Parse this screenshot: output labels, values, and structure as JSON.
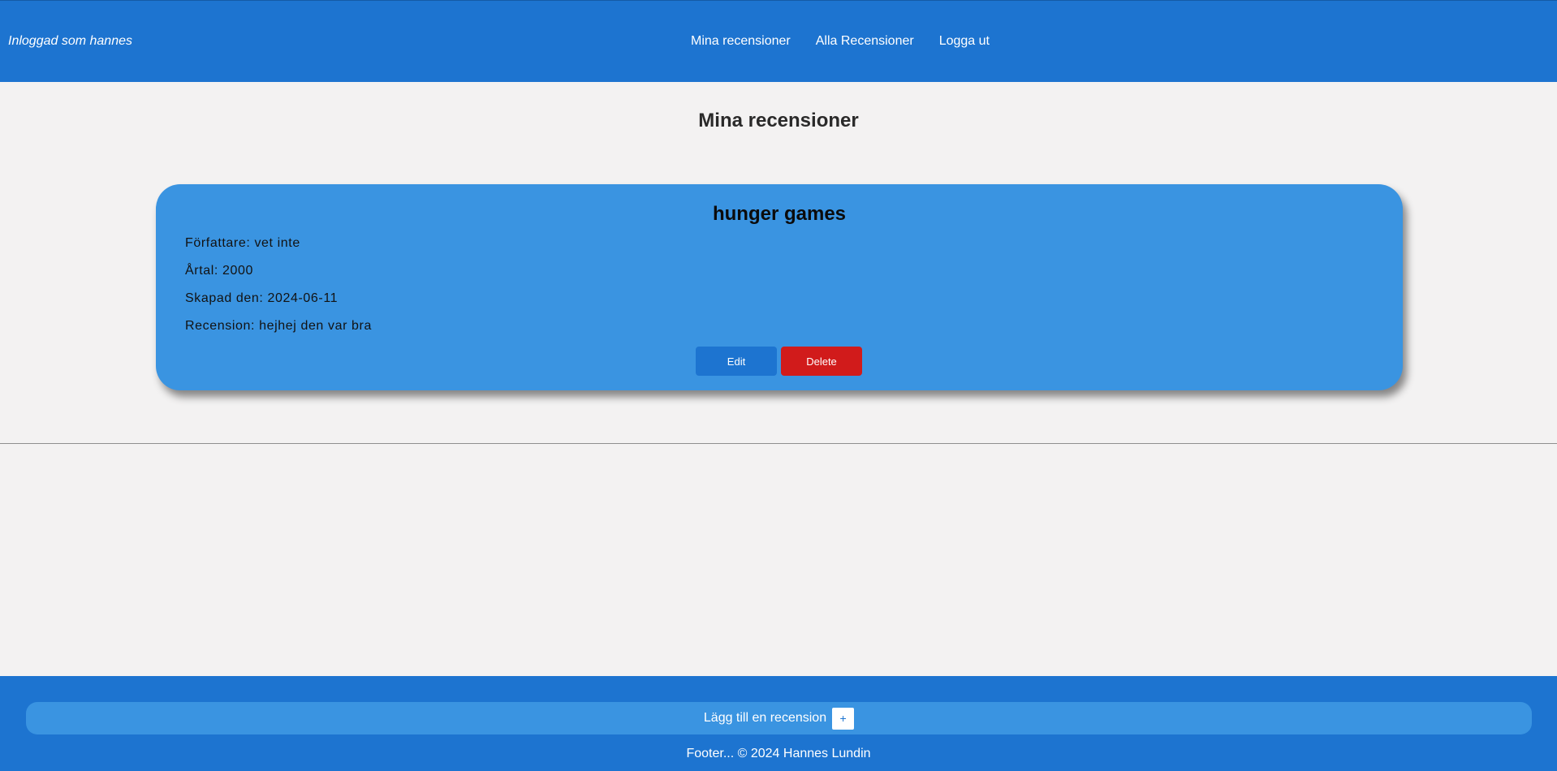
{
  "header": {
    "logged_in_text": "Inloggad som hannes",
    "nav": {
      "my_reviews": "Mina recensioner",
      "all_reviews": "Alla Recensioner",
      "logout": "Logga ut"
    }
  },
  "main": {
    "title": "Mina recensioner",
    "reviews": [
      {
        "title": "hunger games",
        "author": "Författare: vet inte",
        "year": "Årtal: 2000",
        "created": "Skapad den: 2024-06-11",
        "review": "Recension: hejhej den var bra",
        "edit_label": "Edit",
        "delete_label": "Delete"
      }
    ]
  },
  "footer": {
    "add_review_label": "Lägg till en recension",
    "add_icon": "+",
    "footer_text": "Footer... © 2024 Hannes Lundin"
  },
  "colors": {
    "primary": "#1d74d0",
    "card": "#3a94e1",
    "danger": "#d11b1b",
    "background": "#f3f2f2"
  }
}
